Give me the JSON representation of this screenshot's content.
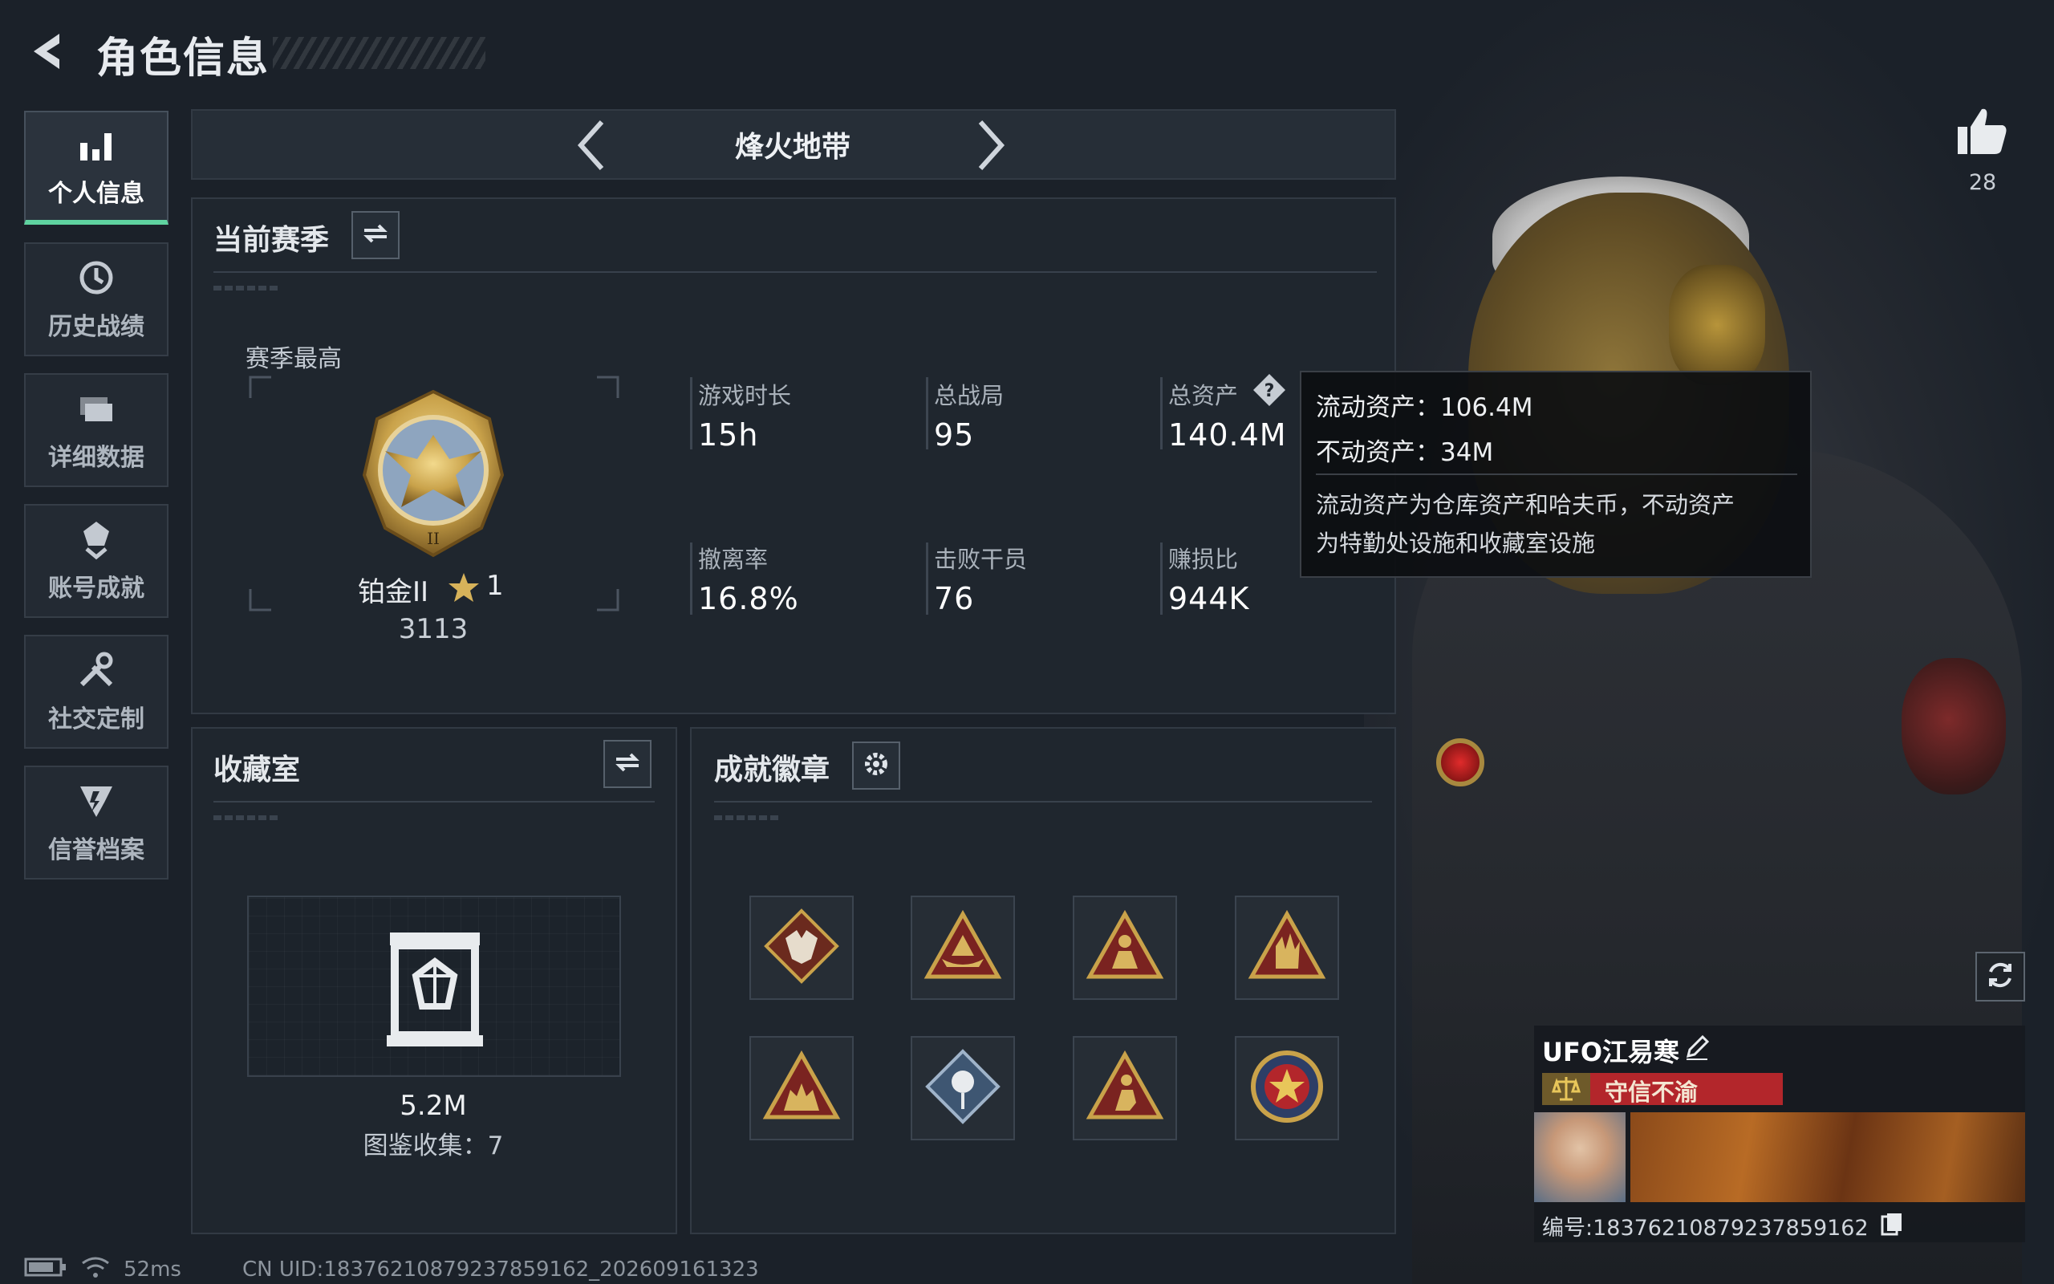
{
  "header": {
    "title": "角色信息",
    "back_icon": "back-arrow-icon"
  },
  "sidebar": {
    "items": [
      {
        "label": "个人信息",
        "icon": "bar-chart-icon",
        "active": true
      },
      {
        "label": "历史战绩",
        "icon": "history-icon",
        "active": false
      },
      {
        "label": "详细数据",
        "icon": "folder-icon",
        "active": false
      },
      {
        "label": "账号成就",
        "icon": "achievement-icon",
        "active": false
      },
      {
        "label": "社交定制",
        "icon": "tools-icon",
        "active": false
      },
      {
        "label": "信誉档案",
        "icon": "shield-icon",
        "active": false
      }
    ]
  },
  "mode": {
    "title": "烽火地带"
  },
  "season": {
    "title": "当前赛季",
    "peak_label": "赛季最高",
    "rank_name": "铂金II",
    "rank_stars": "1",
    "rank_points": "3113",
    "stats": [
      {
        "label": "游戏时长",
        "value": "15h"
      },
      {
        "label": "总战局",
        "value": "95"
      },
      {
        "label": "总资产",
        "value": "140.4M"
      },
      {
        "label": "撤离率",
        "value": "16.8%"
      },
      {
        "label": "击败干员",
        "value": "76"
      },
      {
        "label": "赚损比",
        "value": "944K"
      }
    ]
  },
  "tooltip": {
    "liquid": "流动资产：106.4M",
    "fixed": "不动资产：34M",
    "desc_line1": "流动资产为仓库资产和哈夫币，不动资产",
    "desc_line2": "为特勤处设施和收藏室设施"
  },
  "collection": {
    "title": "收藏室",
    "value": "5.2M",
    "count": "图鉴收集：7"
  },
  "badges": {
    "title": "成就徽章",
    "items": [
      "wolf-badge-icon",
      "boat-badge-icon",
      "soldier-badge-icon",
      "hand-badge-icon",
      "team-badge-icon",
      "rose-badge-icon",
      "runner-badge-icon",
      "star-emblem-badge-icon"
    ]
  },
  "player": {
    "name": "UFO江易寒",
    "credit": "守信不渝",
    "id": "编号:183762108792378591​62",
    "likes": "28"
  },
  "status": {
    "ping": "52ms",
    "uid": "CN UID:183762108792378591​62_202609161323"
  },
  "colors": {
    "accent": "#5fd3a0",
    "gold": "#c9a24a",
    "credit_red": "#b3262b"
  }
}
